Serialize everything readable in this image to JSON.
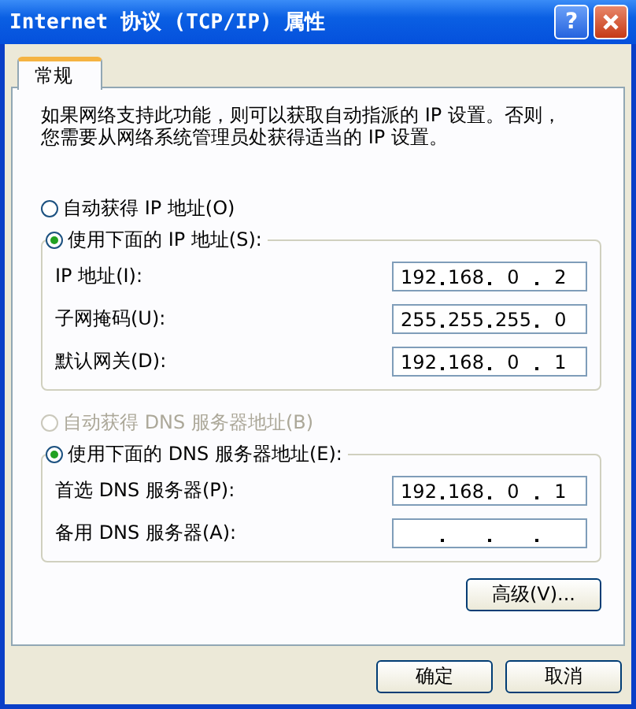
{
  "window": {
    "title": "Internet 协议 (TCP/IP) 属性",
    "help_label": "?"
  },
  "tabs": [
    {
      "label": "常规",
      "selected": true
    }
  ],
  "description": "如果网络支持此功能，则可以获取自动指派的 IP 设置。否则，您需要从网络系统管理员处获得适当的 IP 设置。",
  "ip_section": {
    "auto_option": {
      "label": "自动获得 IP 地址(O)",
      "selected": false,
      "disabled": false
    },
    "manual_option": {
      "label": "使用下面的 IP 地址(S):",
      "selected": true,
      "disabled": false
    },
    "fields": [
      {
        "label": "IP 地址(I):",
        "octets": [
          "192",
          "168",
          "0",
          "2"
        ]
      },
      {
        "label": "子网掩码(U):",
        "octets": [
          "255",
          "255",
          "255",
          "0"
        ]
      },
      {
        "label": "默认网关(D):",
        "octets": [
          "192",
          "168",
          "0",
          "1"
        ]
      }
    ]
  },
  "dns_section": {
    "auto_option": {
      "label": "自动获得 DNS 服务器地址(B)",
      "selected": false,
      "disabled": true
    },
    "manual_option": {
      "label": "使用下面的 DNS 服务器地址(E):",
      "selected": true,
      "disabled": false
    },
    "fields": [
      {
        "label": "首选 DNS 服务器(P):",
        "octets": [
          "192",
          "168",
          "0",
          "1"
        ]
      },
      {
        "label": "备用 DNS 服务器(A):"
      }
    ]
  },
  "advanced_button": "高级(V)...",
  "dialog_buttons": [
    "确定",
    "取消"
  ]
}
